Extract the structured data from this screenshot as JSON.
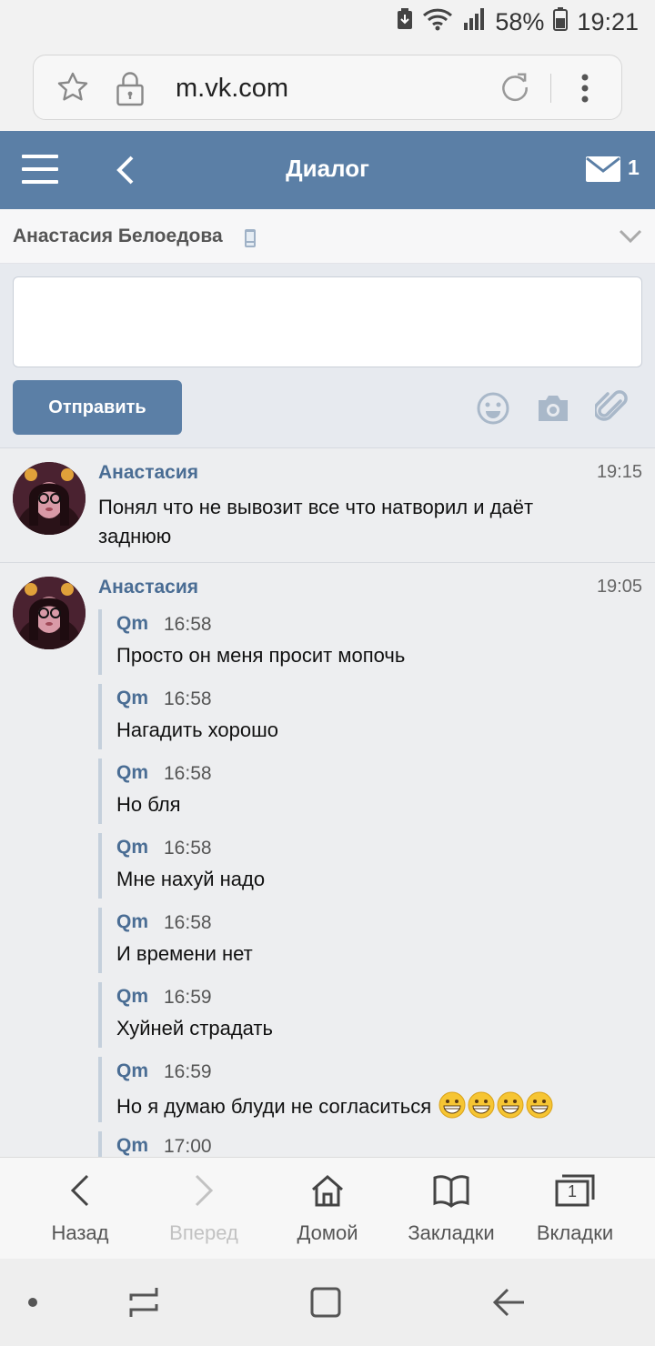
{
  "status_bar": {
    "battery": "58%",
    "time": "19:21"
  },
  "address_bar": {
    "url": "m.vk.com"
  },
  "header": {
    "title": "Диалог",
    "unread_count": "1"
  },
  "dialog": {
    "contact_name": "Анастасия Белоедова"
  },
  "composer": {
    "message_value": "",
    "send_label": "Отправить"
  },
  "messages": [
    {
      "author": "Анастасия",
      "time": "19:15",
      "text": "Понял что не вывозит все что натворил и даёт заднюю"
    },
    {
      "author": "Анастасия",
      "time": "19:05",
      "forwarded": [
        {
          "author": "Qm",
          "time": "16:58",
          "text": "Просто он меня просит мопочь"
        },
        {
          "author": "Qm",
          "time": "16:58",
          "text": "Нагадить хорошо"
        },
        {
          "author": "Qm",
          "time": "16:58",
          "text": "Но бля"
        },
        {
          "author": "Qm",
          "time": "16:58",
          "text": "Мне нахуй надо"
        },
        {
          "author": "Qm",
          "time": "16:58",
          "text": "И времени нет"
        },
        {
          "author": "Qm",
          "time": "16:59",
          "text": "Хуйней страдать"
        },
        {
          "author": "Qm",
          "time": "16:59",
          "text": "Но я думаю блуди не согласиться"
        },
        {
          "author": "Qm",
          "time": "17:00",
          "text": ""
        }
      ]
    }
  ],
  "browser_nav": {
    "back": "Назад",
    "forward": "Вперед",
    "home": "Домой",
    "bookmarks": "Закладки",
    "tabs": "Вкладки",
    "tabs_count": "1"
  },
  "colors": {
    "vk_blue": "#5b7fa6",
    "link_blue": "#4a6d94",
    "background": "#edeef0"
  }
}
